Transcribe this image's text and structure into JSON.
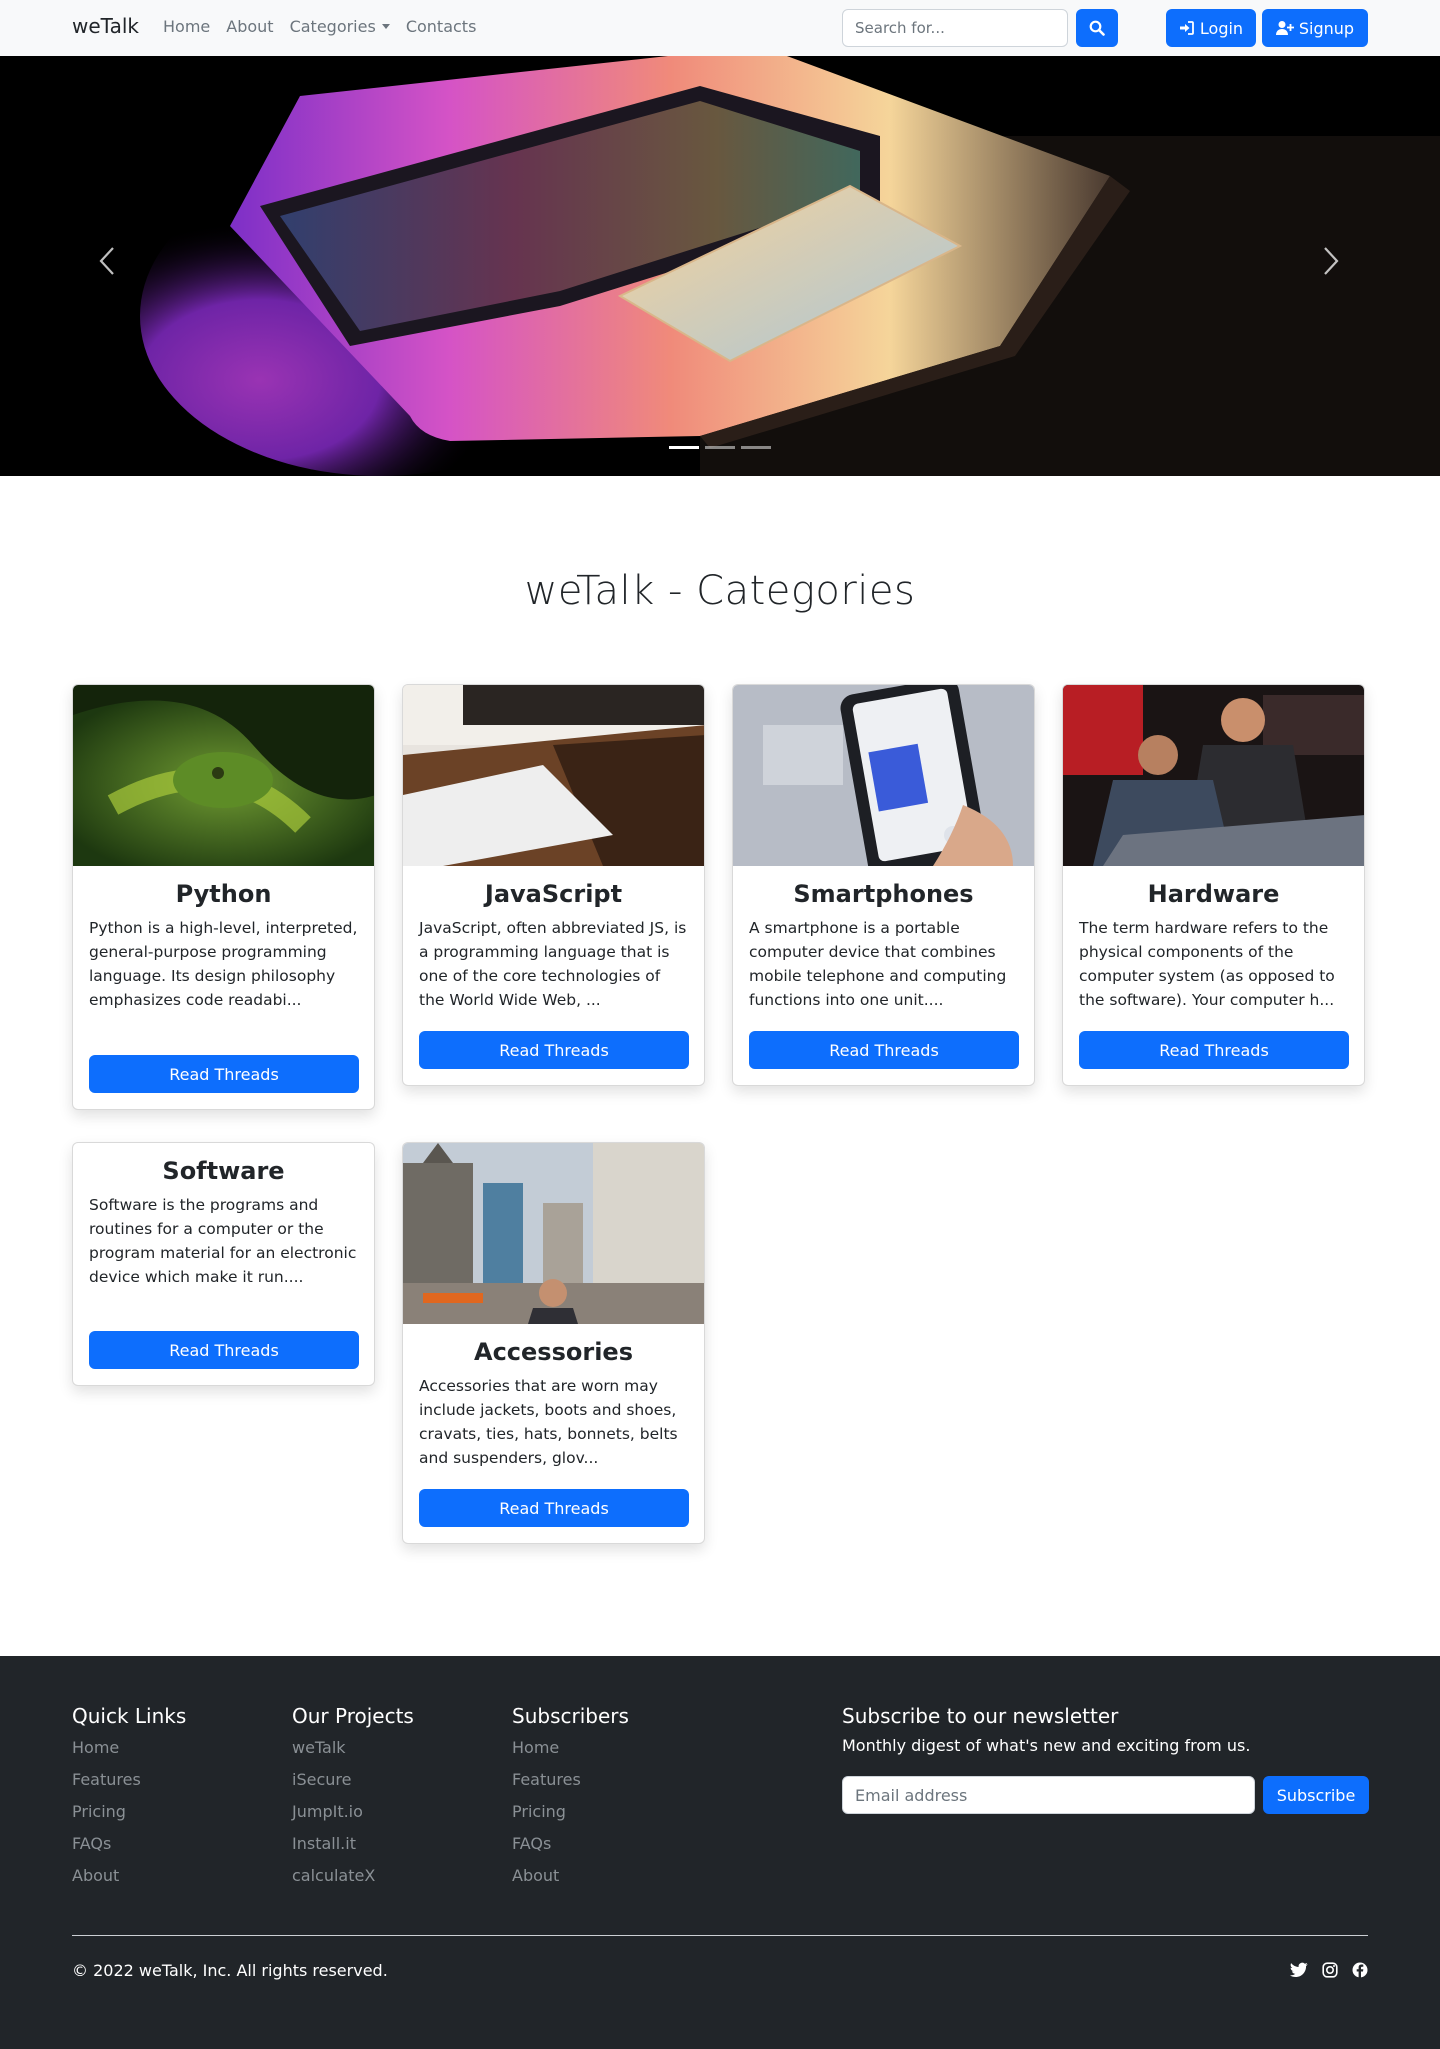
{
  "navbar": {
    "brand": "weTalk",
    "links": [
      "Home",
      "About",
      "Categories",
      "Contacts"
    ],
    "search_placeholder": "Search for...",
    "login_label": "Login",
    "signup_label": "Signup"
  },
  "carousel": {
    "slide_count": 3,
    "active_slide": 1
  },
  "section_title": "weTalk - Categories",
  "categories": [
    {
      "title": "Python",
      "text": "Python is a high-level, interpreted, general-purpose programming language. Its design philosophy emphasizes code readabi...",
      "button": "Read Threads"
    },
    {
      "title": "JavaScript",
      "text": "JavaScript, often abbreviated JS, is a programming language that is one of the core technologies of the World Wide Web, ...",
      "button": "Read Threads"
    },
    {
      "title": "Smartphones",
      "text": "A smartphone is a portable computer device that combines mobile telephone and computing functions into one unit....",
      "button": "Read Threads"
    },
    {
      "title": "Hardware",
      "text": "The term hardware refers to the physical components of the computer system (as opposed to the software). Your computer h...",
      "button": "Read Threads"
    },
    {
      "title": "Software",
      "text": "Software is the programs and routines for a computer or the program material for an electronic device which make it run....",
      "button": "Read Threads"
    },
    {
      "title": "Accessories",
      "text": "Accessories that are worn may include jackets, boots and shoes, cravats, ties, hats, bonnets, belts and suspenders, glov...",
      "button": "Read Threads"
    }
  ],
  "footer": {
    "columns": [
      {
        "heading": "Quick Links",
        "links": [
          "Home",
          "Features",
          "Pricing",
          "FAQs",
          "About"
        ]
      },
      {
        "heading": "Our Projects",
        "links": [
          "weTalk",
          "iSecure",
          "JumpIt.io",
          "Install.it",
          "calculateX"
        ]
      },
      {
        "heading": "Subscribers",
        "links": [
          "Home",
          "Features",
          "Pricing",
          "FAQs",
          "About"
        ]
      }
    ],
    "newsletter": {
      "heading": "Subscribe to our newsletter",
      "subtext": "Monthly digest of what's new and exciting from us.",
      "email_placeholder": "Email address",
      "button": "Subscribe"
    },
    "copyright": "© 2022 weTalk, Inc. All rights reserved.",
    "social_icons": [
      "twitter-icon",
      "instagram-icon",
      "facebook-icon"
    ]
  },
  "colors": {
    "primary": "#0d6efd",
    "navbar_bg": "#f8f9fa",
    "footer_bg": "#212529",
    "muted_link": "#8a9095"
  }
}
